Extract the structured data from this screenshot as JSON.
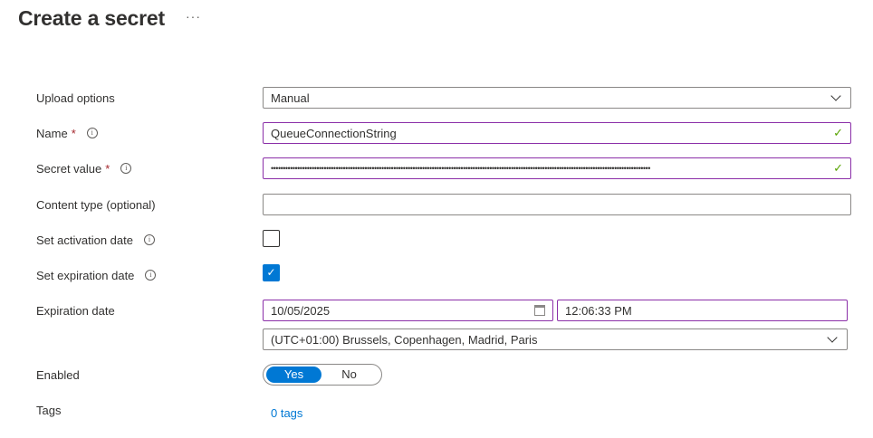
{
  "header": {
    "title": "Create a secret",
    "more": "···"
  },
  "form": {
    "upload_options": {
      "label": "Upload options",
      "value": "Manual"
    },
    "name": {
      "label": "Name",
      "required": "*",
      "value": "QueueConnectionString"
    },
    "secret_value": {
      "label": "Secret value",
      "required": "*",
      "value": "••••••••••••••••••••••••••••••••••••••••••••••••••••••••••••••••••••••••••••••••••••••••••••••••••••••••••••••••••••••••••••••••••••••••••••••••••••••••••••••"
    },
    "content_type": {
      "label": "Content type (optional)",
      "value": ""
    },
    "activation": {
      "label": "Set activation date",
      "checked": false
    },
    "expiration": {
      "label": "Set expiration date",
      "checked": true
    },
    "expiration_date": {
      "label": "Expiration date",
      "date": "10/05/2025",
      "time": "12:06:33 PM",
      "timezone": "(UTC+01:00) Brussels, Copenhagen, Madrid, Paris"
    },
    "enabled": {
      "label": "Enabled",
      "yes": "Yes",
      "no": "No",
      "selected": "Yes"
    },
    "tags": {
      "label": "Tags",
      "link": "0 tags"
    }
  },
  "icons": {
    "info": "i",
    "check": "✓",
    "checkbox_check": "✓"
  },
  "colors": {
    "accent": "#0078d4",
    "valid_border": "#8b2fa8",
    "valid_check": "#57a300",
    "required": "#a4262c"
  }
}
